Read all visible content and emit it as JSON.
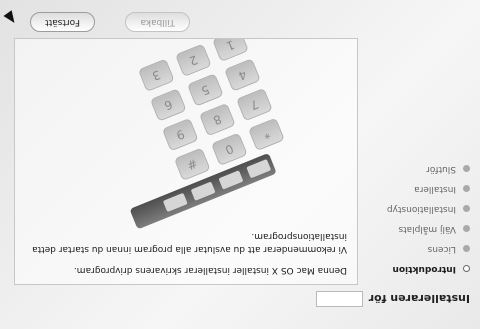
{
  "window": {
    "title": "Installeraren för"
  },
  "steps": [
    {
      "label": "Introduktion",
      "active": true
    },
    {
      "label": "Licens",
      "active": false
    },
    {
      "label": "Välj målplats",
      "active": false
    },
    {
      "label": "Installationstyp",
      "active": false
    },
    {
      "label": "Installera",
      "active": false
    },
    {
      "label": "Slutför",
      "active": false
    }
  ],
  "content": {
    "paragraph_1": "Denna Mac OS X installer installerar skrivarens drivprogram.",
    "paragraph_2": "Vi rekommenderar att du avslutar alla program innan du startar detta installationsprogram."
  },
  "keypad": [
    "*",
    "0",
    "#",
    "7",
    "8",
    "9",
    "4",
    "5",
    "6",
    "1",
    "2",
    "3"
  ],
  "buttons": {
    "back_label": "Tillbaka",
    "continue_label": "Fortsätt"
  },
  "icons": {
    "cursor": "mouse-pointer-icon"
  }
}
